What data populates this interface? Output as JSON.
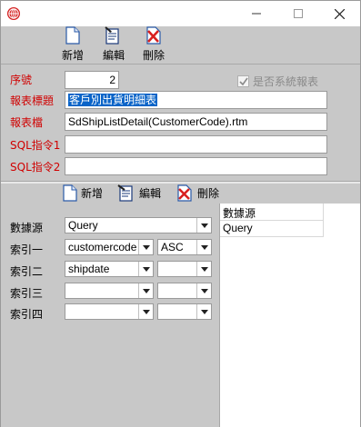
{
  "window": {
    "icon": "app-globe-icon",
    "minimize_glyph": "—",
    "maximize_glyph": "☐",
    "close_glyph": "✕"
  },
  "toolbar": {
    "new_label": "新增",
    "edit_label": "編輯",
    "delete_label": "刪除"
  },
  "form": {
    "seq_label": "序號",
    "seq_value": "2",
    "system_report_label": "是否系統報表",
    "system_report_checked": true,
    "title_label": "報表標題",
    "title_value": "客戶別出貨明細表",
    "file_label": "報表檔",
    "file_value": "SdShipListDetail(CustomerCode).rtm",
    "sql1_label": "SQL指令1",
    "sql1_value": "",
    "sql2_label": "SQL指令2",
    "sql2_value": ""
  },
  "detail_toolbar": {
    "new_label": "新增",
    "edit_label": "編輯",
    "delete_label": "刪除"
  },
  "detail": {
    "datasource_label": "數據源",
    "datasource_value": "Query",
    "index1_label": "索引一",
    "index1_field": "customercode",
    "index1_order": "ASC",
    "index2_label": "索引二",
    "index2_field": "shipdate",
    "index2_order": "",
    "index3_label": "索引三",
    "index3_field": "",
    "index3_order": "",
    "index4_label": "索引四",
    "index4_field": "",
    "index4_order": ""
  },
  "grid": {
    "header": "數據源",
    "rows": [
      "Query"
    ]
  },
  "colors": {
    "label_red": "#d00000",
    "selection_blue": "#0a64c8",
    "panel_gray": "#c8c8c8"
  }
}
